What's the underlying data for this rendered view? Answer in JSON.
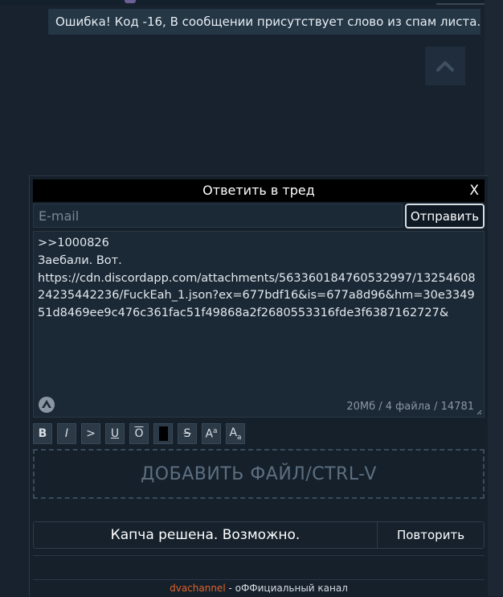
{
  "error": {
    "message": "Ошибка! Код -16, В сообщении присутствует слово из спам листа."
  },
  "reply": {
    "title": "Ответить в тред",
    "close_label": "X",
    "email_placeholder": "E-mail",
    "send_label": "Отправить",
    "message_text": ">>1000826\nЗаебали. Вот.\nhttps://cdn.discordapp.com/attachments/563360184760532997/1325460824235442236/FuckEah_1.json?ex=677bdf16&is=677a8d96&hm=30e334951d8469ee9c476c361fac51f49868a2f2680553316fde3f6387162727&",
    "stats": "20Мб / 4 файла / 14781",
    "add_file_label": "ДОБАВИТЬ ФАЙЛ/CTRL-V",
    "captcha_status": "Капча решена. Возможно.",
    "retry_label": "Повторить"
  },
  "toolbar": {
    "bold": "B",
    "italic": "I",
    "quote": ">",
    "underline": "U",
    "overline": "O",
    "strike": "S",
    "sup": "Aa",
    "sub": "Aa"
  },
  "footer": {
    "channel_link": "dvachannel",
    "channel_suffix": " - оФФициальный канал"
  },
  "colors": {
    "background": "#17222e",
    "panel": "#15202b",
    "accent_link": "#e0622a"
  },
  "icons": {
    "scroll_up": "chevron-up-icon",
    "upload": "upload-icon",
    "spoiler": "spoiler-icon",
    "resize": "resize-grip-icon"
  }
}
